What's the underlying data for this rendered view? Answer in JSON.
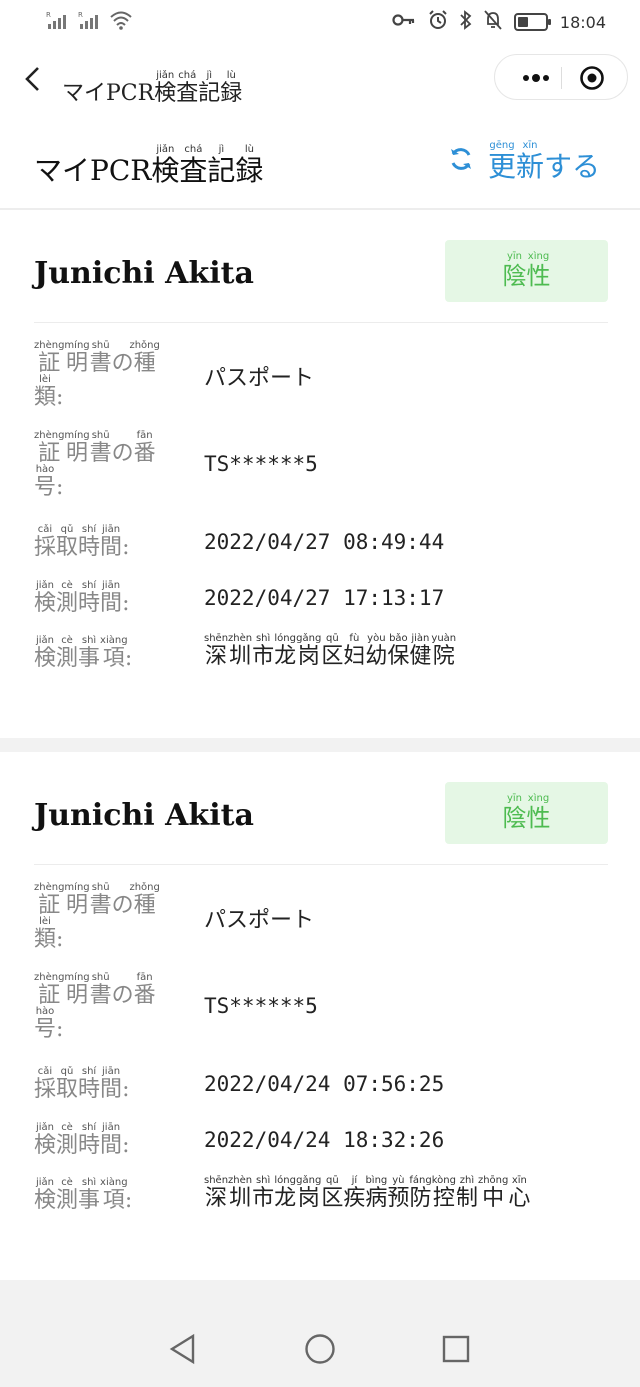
{
  "status_bar": {
    "time": "18:04",
    "battery_level": 0.4,
    "left_icons": [
      "signal-sim1-icon",
      "signal-sim2-icon",
      "wifi-icon"
    ],
    "right_icons": [
      "key-icon",
      "alarm-icon",
      "bluetooth-icon",
      "mute-icon",
      "battery-icon"
    ]
  },
  "navbar": {
    "title": "マイPCR検査記録",
    "title_ruby": [
      "jiǎn",
      "chá",
      "jì",
      "lù"
    ]
  },
  "header": {
    "title_prefix": "マイPCR",
    "title_kanji": [
      "検",
      "査",
      "記",
      "録"
    ],
    "title_ruby": [
      "jiǎn",
      "chá",
      "jì",
      "lù"
    ],
    "refresh_label": "更新する",
    "refresh_kanji": [
      "更",
      "新"
    ],
    "refresh_ruby": [
      "gēng",
      "xīn"
    ],
    "refresh_suffix": "する"
  },
  "labels": {
    "doc_type": "証明書の種類:",
    "doc_number": "証明書の番号:",
    "collect_time": "採取時間:",
    "test_time": "検測時間:",
    "test_place": "検測事項:"
  },
  "records": [
    {
      "name": "Junichi Akita",
      "result": "陰性",
      "result_ruby": [
        "yīn",
        "xìng"
      ],
      "doc_type": "パスポート",
      "doc_number": "TS******5",
      "collect_time": "2022/04/27 08:49:44",
      "test_time": "2022/04/27 17:13:17",
      "test_place": "深圳市龙岗区妇幼保健院",
      "test_place_ruby": [
        "shēn",
        "zhèn",
        "shì",
        "lóng",
        "gǎng",
        "qū",
        "fù",
        "yòu",
        "bǎo",
        "jiàn",
        "yuàn"
      ]
    },
    {
      "name": "Junichi Akita",
      "result": "陰性",
      "result_ruby": [
        "yīn",
        "xìng"
      ],
      "doc_type": "パスポート",
      "doc_number": "TS******5",
      "collect_time": "2022/04/24 07:56:25",
      "test_time": "2022/04/24 18:32:26",
      "test_place": "深圳市龙岗区疾病预防控制中心",
      "test_place_ruby": [
        "shēn",
        "zhèn",
        "shì",
        "lóng",
        "gǎng",
        "qū",
        "jí",
        "bìng",
        "yù",
        "fáng",
        "kòng",
        "zhì",
        "zhōng",
        "xīn"
      ]
    }
  ],
  "label_ruby": {
    "doc_type": [
      [
        "証",
        "zhèng"
      ],
      [
        "明",
        "míng"
      ],
      [
        "書",
        "shū"
      ],
      [
        "の",
        ""
      ],
      [
        "種",
        "zhǒng"
      ],
      [
        "類",
        "lèi"
      ],
      [
        ":",
        ""
      ]
    ],
    "doc_number": [
      [
        "証",
        "zhèng"
      ],
      [
        "明",
        "míng"
      ],
      [
        "書",
        "shū"
      ],
      [
        "の",
        ""
      ],
      [
        "番",
        "fān"
      ],
      [
        "号",
        "hào"
      ],
      [
        ":",
        ""
      ]
    ],
    "collect_time": [
      [
        "採",
        "cǎi"
      ],
      [
        "取",
        "qǔ"
      ],
      [
        "時",
        "shí"
      ],
      [
        "間",
        "jiān"
      ],
      [
        ":",
        ""
      ]
    ],
    "test_time": [
      [
        "検",
        "jiǎn"
      ],
      [
        "測",
        "cè"
      ],
      [
        "時",
        "shí"
      ],
      [
        "間",
        "jiān"
      ],
      [
        ":",
        ""
      ]
    ],
    "test_place": [
      [
        "検",
        "jiǎn"
      ],
      [
        "測",
        "cè"
      ],
      [
        "事",
        "shì"
      ],
      [
        "項",
        "xiàng"
      ],
      [
        ":",
        ""
      ]
    ]
  }
}
